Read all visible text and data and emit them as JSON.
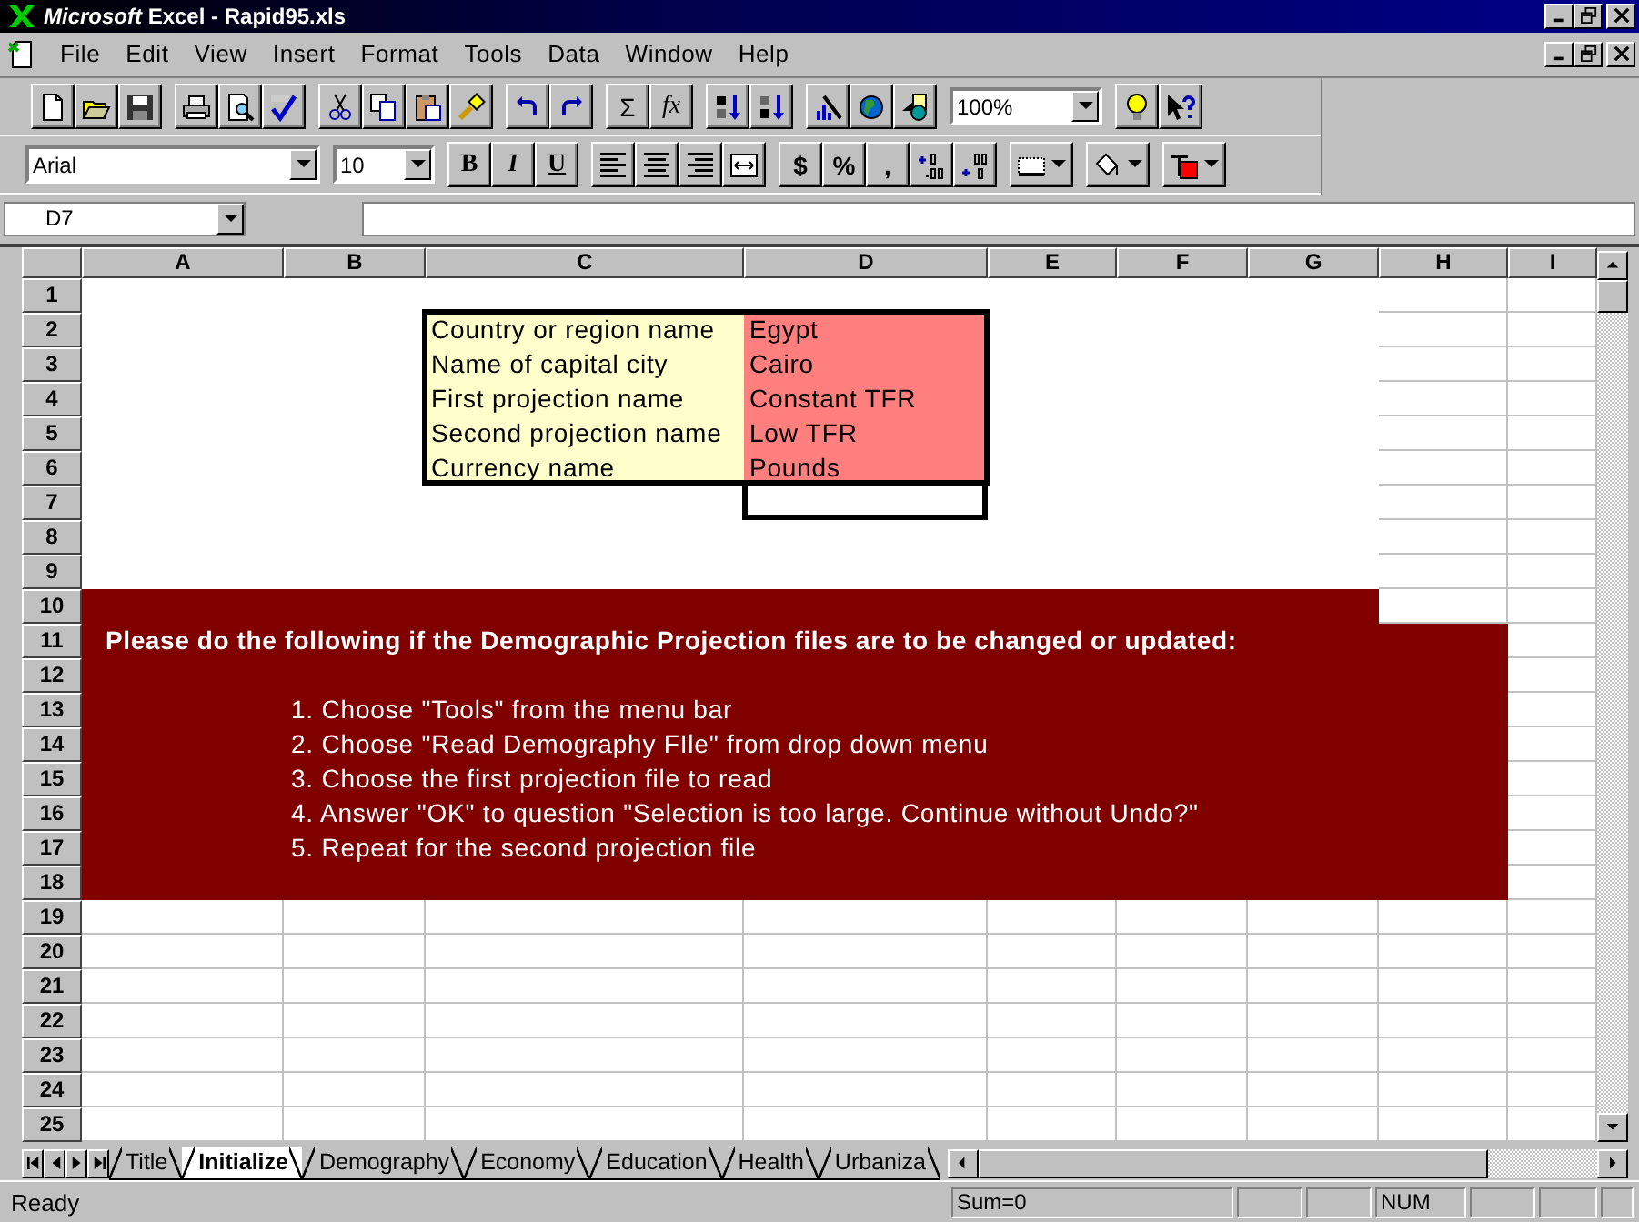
{
  "window": {
    "title": "*Microsoft* Excel - Rapid95.xls"
  },
  "menu": [
    "File",
    "Edit",
    "View",
    "Insert",
    "Format",
    "Tools",
    "Data",
    "Window",
    "Help"
  ],
  "standard_toolbar": {
    "autosum": "Σ",
    "function": "fx",
    "zoom": "100%"
  },
  "formatting_toolbar": {
    "font": "Arial",
    "size": "10",
    "bold": "B",
    "italic": "I",
    "underline": "U",
    "currency": "$",
    "percent": "%",
    "comma": ","
  },
  "formula_bar": {
    "name_box": "D7"
  },
  "sheet": {
    "columns": [
      "A",
      "B",
      "C",
      "D",
      "E",
      "F",
      "G",
      "H",
      "I"
    ],
    "rows": [
      "1",
      "2",
      "3",
      "4",
      "5",
      "6",
      "7",
      "8",
      "9",
      "10",
      "11",
      "12",
      "13",
      "14",
      "15",
      "16",
      "17",
      "18",
      "19",
      "20",
      "21",
      "22",
      "23",
      "24",
      "25"
    ]
  },
  "input_table": {
    "rows": [
      {
        "label": "Country or region name",
        "value": "Egypt"
      },
      {
        "label": "Name of capital city",
        "value": "Cairo"
      },
      {
        "label": "First projection name",
        "value": "Constant TFR"
      },
      {
        "label": "Second projection name",
        "value": "Low TFR"
      },
      {
        "label": "Currency name",
        "value": "Pounds"
      }
    ],
    "entry_cell": {
      "selected": true
    }
  },
  "instructions": {
    "heading": "Please do the following if the Demographic Projection files are to be changed or updated:",
    "steps": [
      "1. Choose \"Tools\" from the menu bar",
      "2. Choose \"Read Demography FIle\" from drop down menu",
      "3. Choose the first projection file to read",
      "4. Answer \"OK\" to question \"Selection is too large. Continue without Undo?\"",
      "5. Repeat for the second projection file"
    ]
  },
  "sheet_tabs": [
    {
      "label": "Title",
      "selected": false
    },
    {
      "label": "Initialize",
      "selected": true
    },
    {
      "label": "Demography",
      "selected": false
    },
    {
      "label": "Economy",
      "selected": false
    },
    {
      "label": "Education",
      "selected": false
    },
    {
      "label": "Health",
      "selected": false
    },
    {
      "label": "Urbaniza",
      "selected": false
    }
  ],
  "status_bar": {
    "message": "Ready",
    "sum": "Sum=0",
    "num_lock": "NUM"
  }
}
